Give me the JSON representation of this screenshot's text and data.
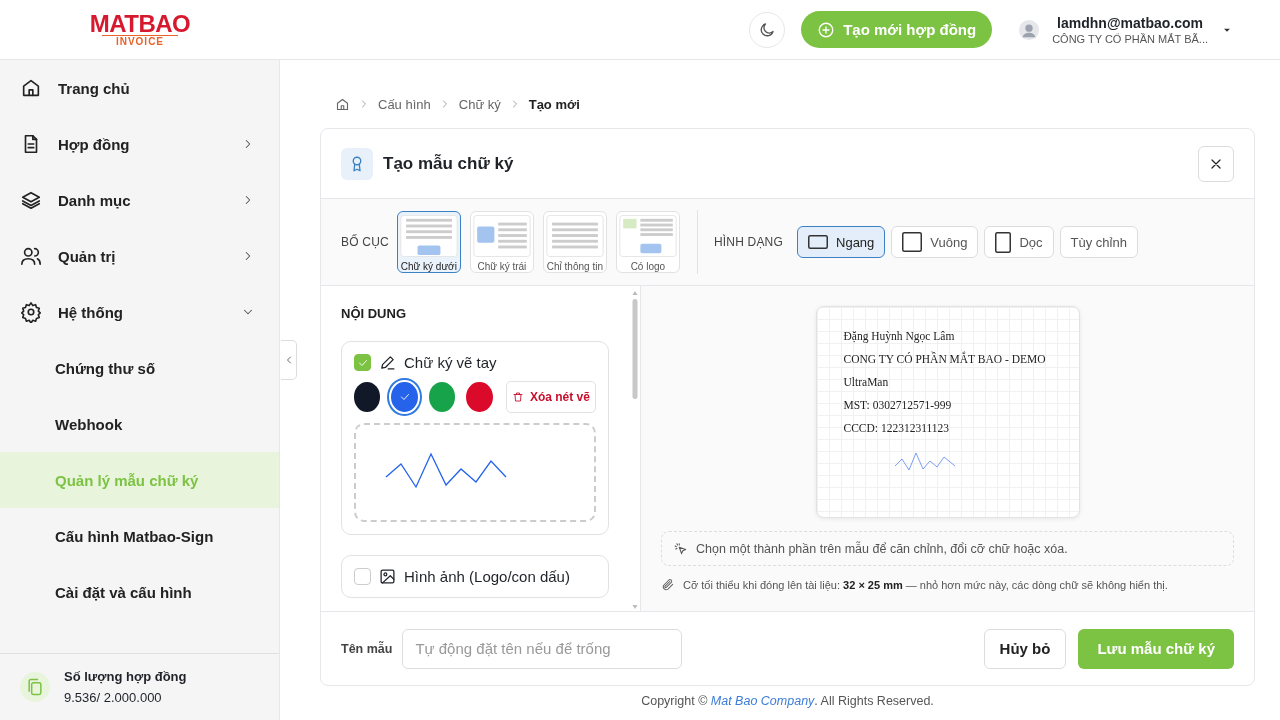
{
  "logo": {
    "brand": "MATBAO",
    "sub": "INVOICE"
  },
  "header": {
    "create_button": "Tạo mới hợp đồng",
    "user": {
      "email": "lamdhn@matbao.com",
      "company": "CÔNG TY CỔ PHẦN MẮT BÃ..."
    }
  },
  "sidebar": {
    "items": [
      {
        "label": "Trang chủ"
      },
      {
        "label": "Hợp đồng",
        "expanded": false
      },
      {
        "label": "Danh mục",
        "expanded": false
      },
      {
        "label": "Quản trị",
        "expanded": false
      },
      {
        "label": "Hệ thống",
        "expanded": true,
        "children": [
          {
            "label": "Chứng thư số",
            "selected": false
          },
          {
            "label": "Webhook",
            "selected": false
          },
          {
            "label": "Quản lý mẫu chữ ký",
            "selected": true
          },
          {
            "label": "Cấu hình Matbao-Sign",
            "selected": false
          },
          {
            "label": "Cài đặt và cấu hình",
            "selected": false
          }
        ]
      }
    ],
    "quota": {
      "label": "Số lượng hợp đồng",
      "value": "9.536/ 2.000.000"
    }
  },
  "breadcrumb": [
    "Cấu hình",
    "Chữ ký",
    "Tạo mới"
  ],
  "dialog": {
    "title": "Tạo mẫu chữ ký",
    "layout": {
      "label": "BỐ CỤC",
      "options": [
        {
          "label": "Chữ ký dưới",
          "kind": "bottom",
          "selected": true
        },
        {
          "label": "Chữ ký trái",
          "kind": "left",
          "selected": false
        },
        {
          "label": "Chỉ thông tin",
          "kind": "info",
          "selected": false
        },
        {
          "label": "Có logo",
          "kind": "logo",
          "selected": false
        }
      ]
    },
    "shape": {
      "label": "HÌNH DẠNG",
      "options": [
        {
          "label": "Ngang",
          "kind": "wide",
          "selected": true
        },
        {
          "label": "Vuông",
          "kind": "square",
          "selected": false
        },
        {
          "label": "Dọc",
          "kind": "tall",
          "selected": false
        },
        {
          "label": "Tùy chỉnh",
          "kind": "custom",
          "selected": false
        }
      ]
    },
    "content": {
      "heading": "NỘI DUNG",
      "sections": [
        {
          "kind": "drawing",
          "label": "Chữ ký vẽ tay",
          "checked": true,
          "colors": [
            {
              "color": "#111827",
              "selected": false
            },
            {
              "color": "#2563eb",
              "selected": true
            },
            {
              "color": "#16a34a",
              "selected": false
            },
            {
              "color": "#dc0a2a",
              "selected": false
            }
          ],
          "clear_button": "Xóa nét vẽ"
        },
        {
          "kind": "image",
          "label": "Hình ảnh (Logo/con dấu)",
          "checked": false
        }
      ]
    },
    "preview": {
      "lines": [
        "Đặng Huỳnh Ngọc Lâm",
        "CONG TY CÓ PHẦN MẮT BAO - DEMO",
        "UltraMan",
        "MST: 0302712571-999",
        "CCCD: 122312311123"
      ],
      "hint": "Chọn một thành phần trên mẫu để căn chỉnh, đổi cỡ chữ hoặc xóa.",
      "note": "Cỡ tối thiểu khi đóng lên tài liệu: **32 × 25 mm** — nhỏ hơn mức này, các dòng chữ sẽ không hiển thị."
    },
    "footer": {
      "name_label": "Tên mẫu",
      "name_placeholder": "Tự động đặt tên nếu để trống",
      "cancel": "Hủy bỏ",
      "save": "Lưu mẫu chữ ký"
    }
  },
  "copyright": {
    "before": "Copyright © ",
    "link": "Mat Bao Company",
    "after": ". All Rights Reserved."
  }
}
